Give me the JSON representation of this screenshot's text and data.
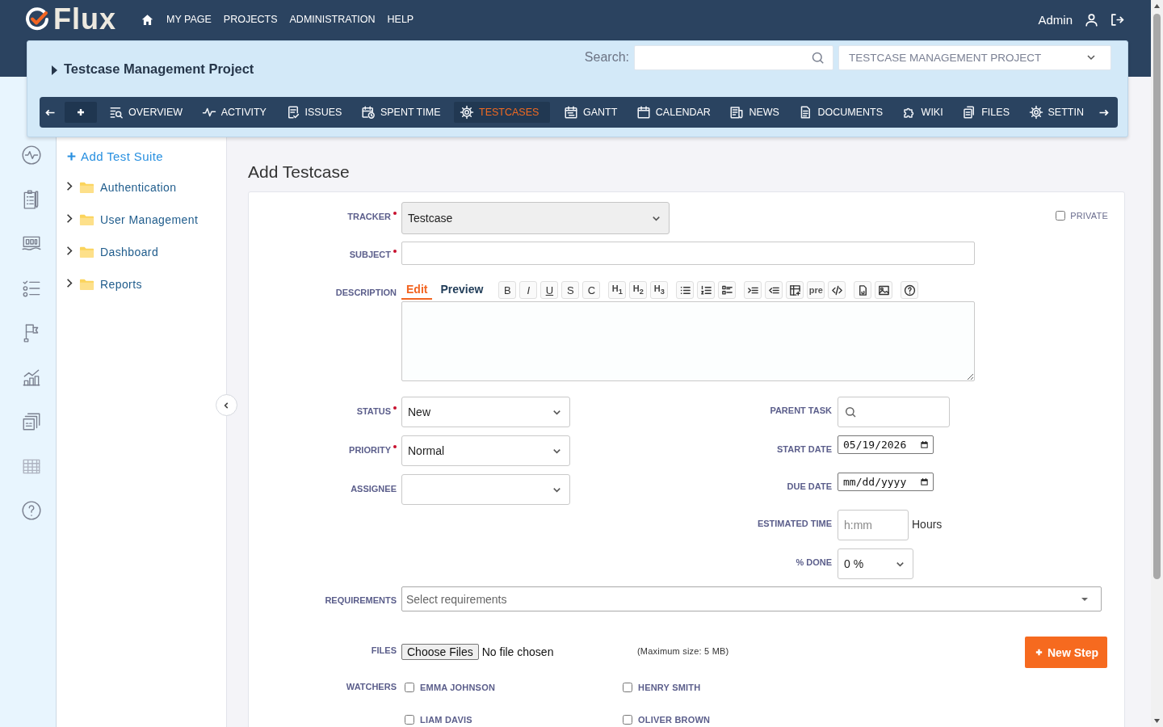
{
  "header": {
    "logo": "Flux",
    "menu": [
      "MY PAGE",
      "PROJECTS",
      "ADMINISTRATION",
      "HELP"
    ],
    "user": "Admin"
  },
  "project": {
    "title": "Testcase Management Project",
    "search_label": "Search:",
    "project_select": "TESTCASE MANAGEMENT PROJECT",
    "tabs": [
      {
        "label": "OVERVIEW",
        "selected": false
      },
      {
        "label": "ACTIVITY",
        "selected": false
      },
      {
        "label": "ISSUES",
        "selected": false
      },
      {
        "label": "SPENT TIME",
        "selected": false
      },
      {
        "label": "TESTCASES",
        "selected": true
      },
      {
        "label": "GANTT",
        "selected": false
      },
      {
        "label": "CALENDAR",
        "selected": false
      },
      {
        "label": "NEWS",
        "selected": false
      },
      {
        "label": "DOCUMENTS",
        "selected": false
      },
      {
        "label": "WIKI",
        "selected": false
      },
      {
        "label": "FILES",
        "selected": false
      },
      {
        "label": "SETTIN",
        "selected": false
      }
    ]
  },
  "tree": {
    "add_label": "Add Test Suite",
    "items": [
      {
        "label": "Authentication",
        "expanded": false
      },
      {
        "label": "User Management",
        "expanded": false
      },
      {
        "label": "Dashboard",
        "expanded": false
      },
      {
        "label": "Reports",
        "expanded": false
      }
    ]
  },
  "page_title": "Add Testcase",
  "form": {
    "tracker": {
      "label": "TRACKER",
      "required": true,
      "value": "Testcase"
    },
    "private": {
      "label": "PRIVATE",
      "checked": false
    },
    "subject": {
      "label": "SUBJECT",
      "required": true
    },
    "description": {
      "label": "DESCRIPTION",
      "tabs": [
        {
          "label": "Edit",
          "selected": true
        },
        {
          "label": "Preview",
          "selected": false
        }
      ],
      "toolbar": [
        "B",
        "I",
        "U",
        "S",
        "C",
        "H$_{1}$",
        "H$_{2}$",
        "H$_{3}$",
        "pre"
      ]
    },
    "left_fields": [
      {
        "label": "STATUS",
        "required": true,
        "value": "New"
      },
      {
        "label": "PRIORITY",
        "required": true,
        "value": "Normal"
      },
      {
        "label": "ASSIGNEE",
        "required": false
      }
    ],
    "right_fields": [
      {
        "kind": "search",
        "label": "PARENT TASK"
      },
      {
        "kind": "date",
        "label": "START DATE",
        "value": "05/19/2026"
      },
      {
        "kind": "date",
        "label": "DUE DATE",
        "placeholder": "mm/dd/yyyy"
      },
      {
        "kind": "time",
        "label": "ESTIMATED TIME",
        "placeholder": "h:mm",
        "unit": "Hours"
      },
      {
        "kind": "select",
        "label": "% DONE",
        "value": "0 %"
      }
    ],
    "requirements": {
      "label": "REQUIREMENTS",
      "placeholder": "Select requirements"
    },
    "files": {
      "label": "FILES",
      "button": "Choose Files",
      "status": "No file chosen",
      "note": "(Maximum size: 5 MB)"
    },
    "new_step": "New Step",
    "watchers": {
      "label": "WATCHERS",
      "people": [
        {
          "name": "EMMA JOHNSON",
          "checked": false
        },
        {
          "name": "HENRY SMITH",
          "checked": false
        },
        {
          "name": "LIAM DAVIS",
          "checked": false
        },
        {
          "name": "OLIVER BROWN",
          "checked": false
        }
      ]
    }
  }
}
